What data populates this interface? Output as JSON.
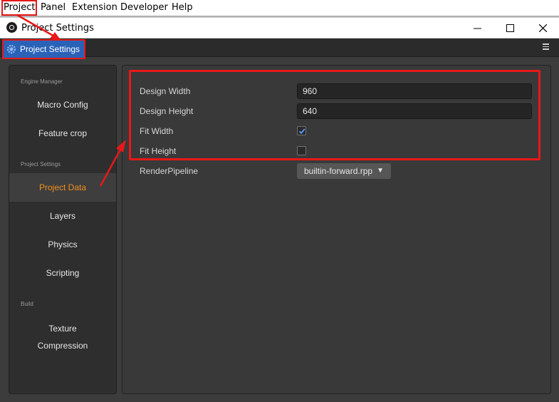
{
  "menu": {
    "items": [
      "Project",
      "Panel",
      "Extension",
      "Developer",
      "Help"
    ]
  },
  "window": {
    "title": "Project Settings",
    "minimize_icon": "minimize-icon",
    "maximize_icon": "maximize-icon",
    "close_icon": "close-icon"
  },
  "panel": {
    "tab_label": "Project Settings",
    "tab_icon": "gear-icon",
    "menu_icon": "hamburger-menu-icon",
    "accent": "#2a62b8"
  },
  "sidebar": {
    "groups": {
      "engine": "Engine Manager",
      "project": "Project Settings",
      "build": "Build"
    },
    "items": {
      "macro": "Macro Config",
      "feature": "Feature crop",
      "project_data": "Project Data",
      "layers": "Layers",
      "physics": "Physics",
      "scripting": "Scripting",
      "texture_line1": "Texture",
      "texture_line2": "Compression"
    },
    "active_color": "#f0901e"
  },
  "settings": {
    "design_width_label": "Design Width",
    "design_width_value": "960",
    "design_height_label": "Design Height",
    "design_height_value": "640",
    "fit_width_label": "Fit Width",
    "fit_width_checked": true,
    "fit_height_label": "Fit Height",
    "fit_height_checked": false,
    "render_pipeline_label": "RenderPipeline",
    "render_pipeline_value": "builtin-forward.rpp"
  },
  "annotation_color": "#e81818"
}
